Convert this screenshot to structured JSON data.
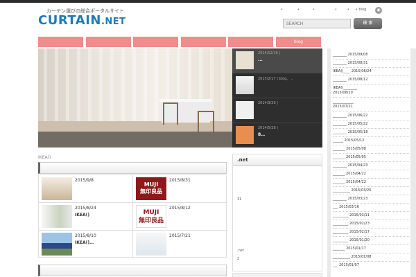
{
  "header": {
    "logo_tagline": "カーテン選びの総合ポータルサイト",
    "logo_main": "CURTAIN",
    "logo_suffix": ".NET",
    "top_links": [
      "•",
      "•",
      "•",
      "•",
      "•",
      "• blog"
    ],
    "rss_icon": "rss-icon",
    "search_placeholder": "SEARCH",
    "search_button": "検 索"
  },
  "nav": {
    "items": [
      "",
      "",
      "",
      "",
      "",
      "blog"
    ],
    "color": "#f38b8b"
  },
  "slider": {
    "items": [
      {
        "date": "2014/12/16 |",
        "title": "..."
      },
      {
        "date": "2015/2/17 | blog、 、",
        "title": ""
      },
      {
        "date": "2014/3/26 |",
        "title": ""
      },
      {
        "date": "2014/5/28 |",
        "title": "8…"
      }
    ]
  },
  "breadcrumb": "IKEA()",
  "posts": [
    {
      "date": "2015/9/8",
      "title": ""
    },
    {
      "date": "2015/8/31",
      "title": "",
      "image_text": "MUJI\n無印良品"
    },
    {
      "date": "2015/8/24",
      "title": "IKEA()"
    },
    {
      "date": "2015/8/12",
      "title": "",
      "image_text": "MUJI\n無印良品"
    },
    {
      "date": "2015/8/10",
      "title": "IKEA()…"
    },
    {
      "date": "2015/7/21",
      "title": ""
    }
  ],
  "mid_panel": {
    "title": ".net",
    "line1": "31",
    "line2": ".net",
    "line3": "2"
  },
  "archive": [
    {
      "label": "________ 2015/09/08"
    },
    {
      "label": "________ 2015/08/31"
    },
    {
      "label": "IKEA()____ 2015/08/24"
    },
    {
      "label": "________ 2015/08/12"
    },
    {
      "label": "IKEA()________"
    },
    {
      "label": "2015/08/10"
    },
    {
      "label": "____________"
    },
    {
      "label": "2015/07/21"
    },
    {
      "label": "________ 2015/06/22"
    },
    {
      "label": "________ 2015/05/22"
    },
    {
      "label": "________ 2015/05/18"
    },
    {
      "label": "______ 2015/05/12"
    },
    {
      "label": "_______ 2015/05/08"
    },
    {
      "label": "_______ 2015/05/05"
    },
    {
      "label": "________ 2015/04/23"
    },
    {
      "label": "_______ 2015/04/22"
    },
    {
      "label": "_______ 2015/04/22"
    },
    {
      "label": "__________ 2015/03/25"
    },
    {
      "label": "________ 2015/03/23"
    },
    {
      "label": "___ 2015/03/16"
    },
    {
      "label": "_________ 2015/03/11"
    },
    {
      "label": "_________ 2015/02/23"
    },
    {
      "label": "_________ 2015/02/17"
    },
    {
      "label": "_________ 2015/01/20"
    },
    {
      "label": "_______ 2015/01/17"
    },
    {
      "label": "__________ 2015/01/08"
    },
    {
      "label": "___ 2015/01/07"
    }
  ]
}
